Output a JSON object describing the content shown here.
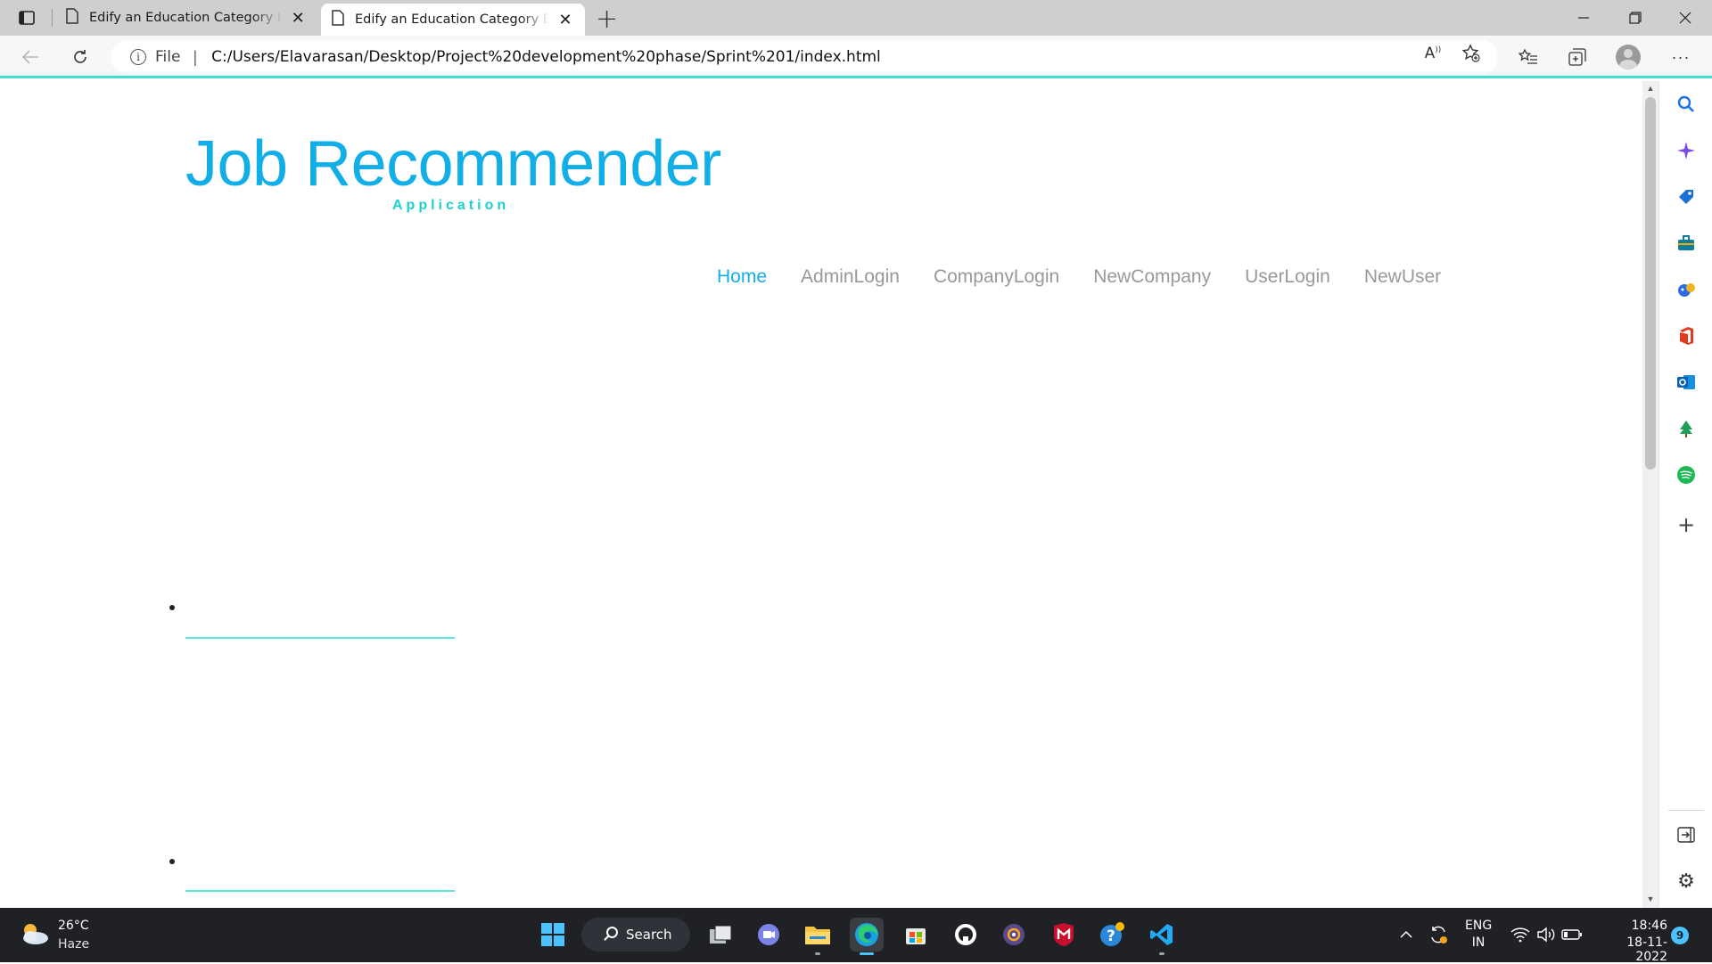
{
  "browser": {
    "tabs": [
      {
        "title": "Edify an Education Category Book"
      },
      {
        "title": "Edify an Education Category Book"
      }
    ],
    "address": {
      "scheme_label": "File",
      "url": "C:/Users/Elavarasan/Desktop/Project%20development%20phase/Sprint%201/index.html"
    }
  },
  "page": {
    "brand": {
      "title": "Job Recommender",
      "subtitle": "Application"
    },
    "menu": [
      {
        "label": "Home",
        "active": true
      },
      {
        "label": "AdminLogin",
        "active": false
      },
      {
        "label": "CompanyLogin",
        "active": false
      },
      {
        "label": "NewCompany",
        "active": false
      },
      {
        "label": "UserLogin",
        "active": false
      },
      {
        "label": "NewUser",
        "active": false
      }
    ],
    "accent_color": "#11aee8",
    "secondary_color": "#1fcfcf"
  },
  "sidebar_icons": [
    "search-icon",
    "copilot-icon",
    "tag-icon",
    "tools-icon",
    "games-icon",
    "office-icon",
    "outlook-icon",
    "tree-icon",
    "spotify-icon",
    "add-icon",
    "hide-sidebar-icon",
    "settings-icon"
  ],
  "taskbar": {
    "weather": {
      "temp": "26°C",
      "condition": "Haze"
    },
    "search_label": "Search",
    "tray": {
      "lang_top": "ENG",
      "lang_bottom": "IN",
      "time": "18:46",
      "date": "18-11-2022",
      "notification_count": "9"
    }
  }
}
